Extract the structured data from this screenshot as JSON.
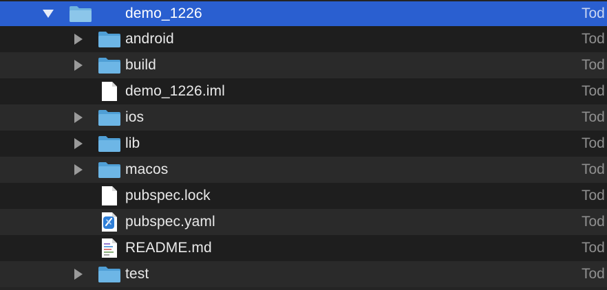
{
  "rows": [
    {
      "name": "demo_1226",
      "kind": "folder",
      "expanded": true,
      "date": "Tod"
    },
    {
      "name": "android",
      "kind": "folder",
      "expanded": false,
      "date": "Tod"
    },
    {
      "name": "build",
      "kind": "folder",
      "expanded": false,
      "date": "Tod"
    },
    {
      "name": "demo_1226.iml",
      "kind": "file",
      "date": "Tod"
    },
    {
      "name": "ios",
      "kind": "folder",
      "expanded": false,
      "date": "Tod"
    },
    {
      "name": "lib",
      "kind": "folder",
      "expanded": false,
      "date": "Tod"
    },
    {
      "name": "macos",
      "kind": "folder",
      "expanded": false,
      "date": "Tod"
    },
    {
      "name": "pubspec.lock",
      "kind": "file",
      "date": "Tod"
    },
    {
      "name": "pubspec.yaml",
      "kind": "yaml",
      "date": "Tod"
    },
    {
      "name": "README.md",
      "kind": "markdown",
      "date": "Tod"
    },
    {
      "name": "test",
      "kind": "folder",
      "expanded": false,
      "date": "Tod"
    }
  ],
  "colors": {
    "selection": "#2a5fd0",
    "folder": "#5aa7d9",
    "folder_tab": "#7fc0e8"
  }
}
